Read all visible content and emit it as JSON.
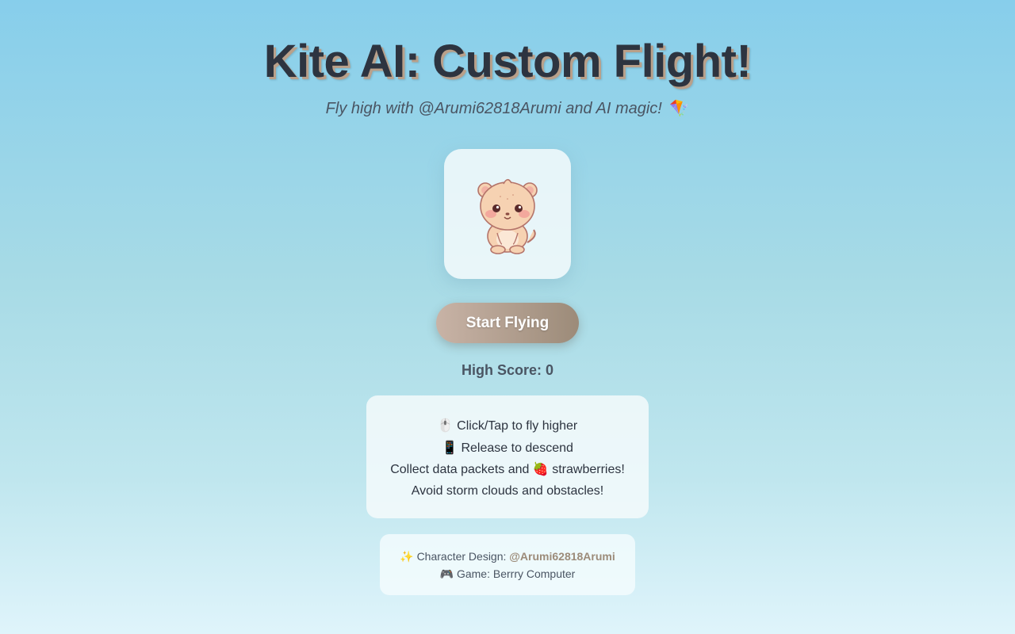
{
  "header": {
    "title": "Kite AI: Custom Flight!",
    "subtitle": "Fly high with @Arumi62818Arumi and AI magic!",
    "subtitle_emoji": "🪁"
  },
  "character": {
    "icon": "bear-cub-icon"
  },
  "start_button": {
    "label": "Start Flying"
  },
  "high_score": {
    "text": "High Score: 0"
  },
  "instructions": {
    "line1_emoji": "🖱️",
    "line1": "Click/Tap to fly higher",
    "line2_emoji": "📱",
    "line2": "Release to descend",
    "line3_prefix": "Collect data packets and",
    "line3_emoji": "🍓",
    "line3_suffix": "strawberries!",
    "line4": "Avoid storm clouds and obstacles!"
  },
  "credits": {
    "design_emoji": "✨",
    "design_label": "Character Design:",
    "design_handle": "@Arumi62818Arumi",
    "game_emoji": "🎮",
    "game_label": "Game: Berrry Computer"
  },
  "colors": {
    "accent": "#9c8b79",
    "title": "#2d3440",
    "sky_top": "#87ceeb",
    "sky_bottom": "#dff4fb"
  }
}
